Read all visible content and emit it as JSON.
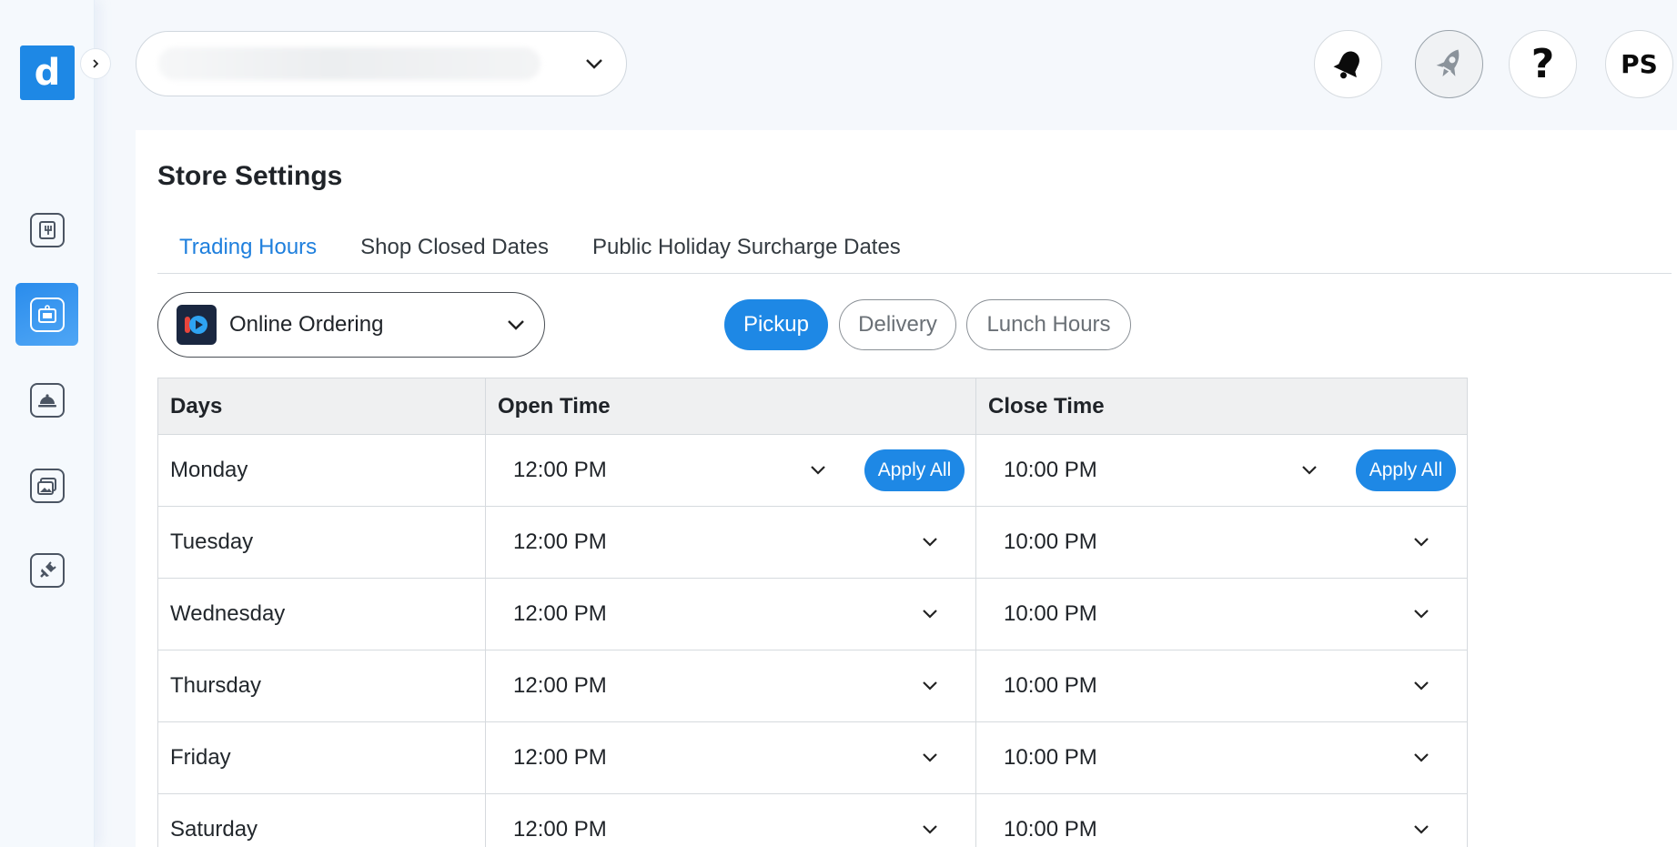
{
  "sidebar": {
    "logo_letter": "d",
    "nav_items": [
      {
        "icon": "menu-book-icon",
        "active": false
      },
      {
        "icon": "store-icon",
        "active": true
      },
      {
        "icon": "food-cloche-icon",
        "active": false
      },
      {
        "icon": "gallery-icon",
        "active": false
      },
      {
        "icon": "plug-icon",
        "active": false
      }
    ]
  },
  "header": {
    "store_select_value": "",
    "notification_icon": "bell-icon",
    "launch_icon": "rocket-icon",
    "help_label": "?",
    "avatar_initials": "PS"
  },
  "page": {
    "title": "Store Settings",
    "tabs": [
      {
        "label": "Trading Hours",
        "active": true
      },
      {
        "label": "Shop Closed Dates",
        "active": false
      },
      {
        "label": "Public Holiday Surcharge Dates",
        "active": false
      }
    ],
    "channel_select": {
      "label": "Online Ordering"
    },
    "modes": [
      {
        "label": "Pickup",
        "active": true
      },
      {
        "label": "Delivery",
        "active": false
      },
      {
        "label": "Lunch Hours",
        "active": false
      }
    ]
  },
  "table": {
    "headers": {
      "days": "Days",
      "open": "Open Time",
      "close": "Close Time"
    },
    "apply_all_label": "Apply All",
    "rows": [
      {
        "day": "Monday",
        "open": "12:00 PM",
        "close": "10:00 PM"
      },
      {
        "day": "Tuesday",
        "open": "12:00 PM",
        "close": "10:00 PM"
      },
      {
        "day": "Wednesday",
        "open": "12:00 PM",
        "close": "10:00 PM"
      },
      {
        "day": "Thursday",
        "open": "12:00 PM",
        "close": "10:00 PM"
      },
      {
        "day": "Friday",
        "open": "12:00 PM",
        "close": "10:00 PM"
      },
      {
        "day": "Saturday",
        "open": "12:00 PM",
        "close": "10:00 PM"
      }
    ]
  },
  "colors": {
    "accent": "#1e88e5",
    "tab_active": "#1e7fdd",
    "background": "#f5f8fc"
  }
}
